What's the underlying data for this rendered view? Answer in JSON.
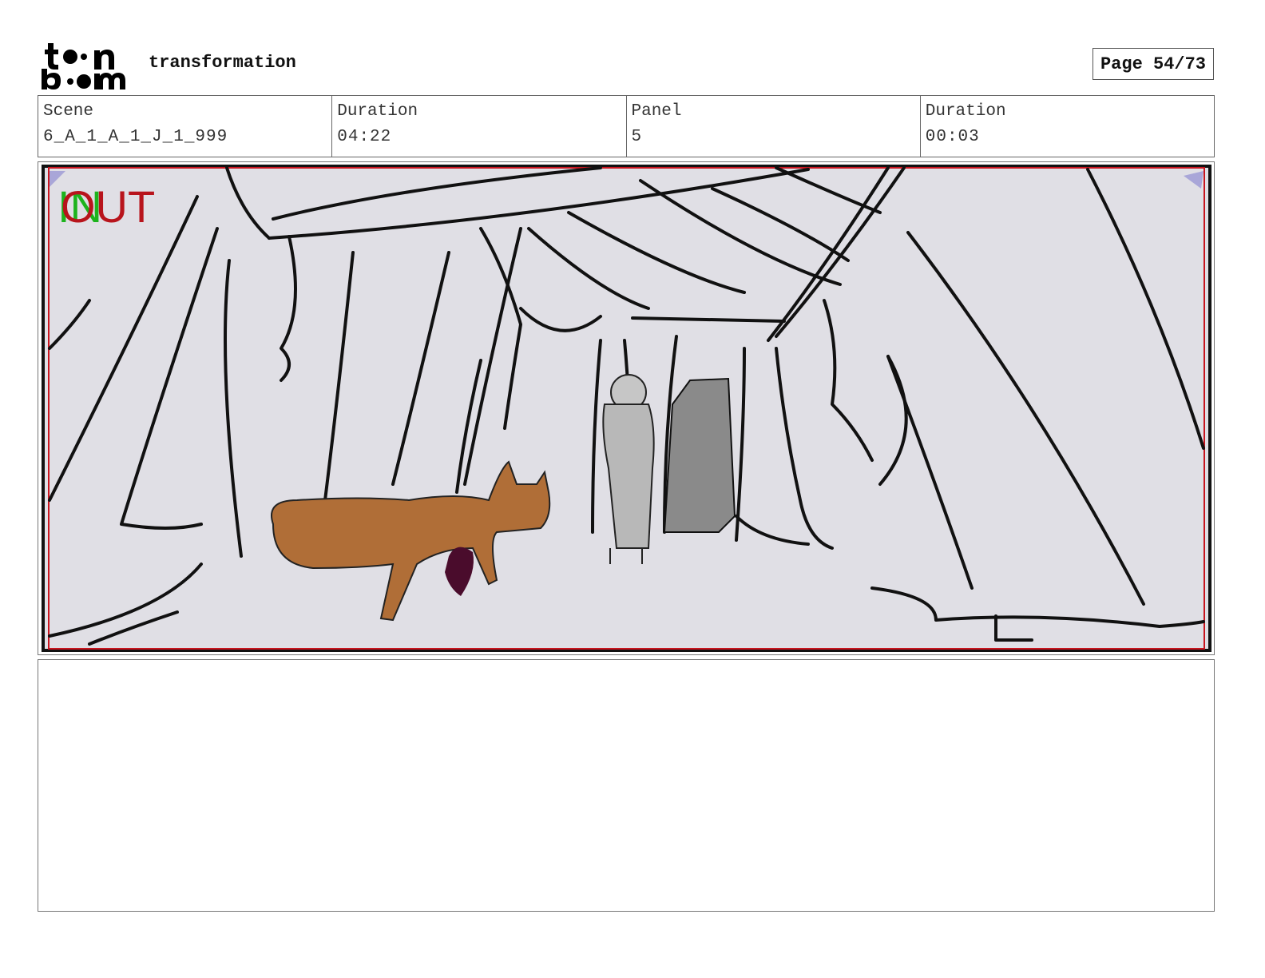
{
  "header": {
    "logo_text": "toonboom",
    "project_title": "transformation",
    "page_indicator": "Page 54/73"
  },
  "info": {
    "scene_label": "Scene",
    "scene_value": "6_A_1_A_1_J_1_999",
    "duration_label": "Duration",
    "duration_value": "04:22",
    "panel_label": "Panel",
    "panel_value": "5",
    "panel_duration_label": "Duration",
    "panel_duration_value": "00:03"
  },
  "panel": {
    "in_marker": "IN",
    "out_marker": "OUT",
    "colors": {
      "background": "#e0dfe5",
      "frame_border": "#111111",
      "safe_area_border": "#c8141e",
      "in_marker": "#1db31d",
      "out_marker": "#b8141c",
      "fox": "#b06e37",
      "fox_held_item": "#4a0c2c",
      "figure": "#b8b8b8",
      "doorway": "#8a8a8a"
    }
  },
  "notes": {
    "text": ""
  }
}
